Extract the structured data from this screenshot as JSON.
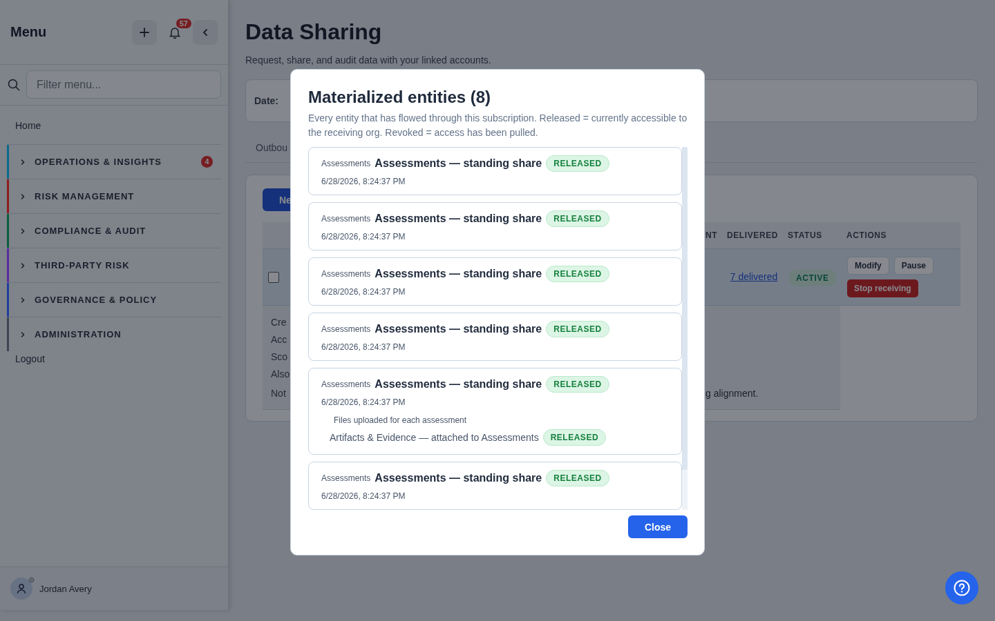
{
  "sidebar": {
    "title": "Menu",
    "notification_count": "57",
    "filter": {
      "placeholder": "Filter menu..."
    },
    "items": [
      {
        "kind": "link",
        "label": "Home"
      },
      {
        "kind": "group",
        "label": "OPERATIONS & INSIGHTS",
        "color": "#0b6a8c",
        "badge": "4",
        "expanded": false
      },
      {
        "kind": "group",
        "label": "RISK MANAGEMENT",
        "color": "#8f1d1d",
        "expanded": false
      },
      {
        "kind": "group",
        "label": "COMPLIANCE & AUDIT",
        "color": "#0b5e40",
        "expanded": false
      },
      {
        "kind": "group",
        "label": "THIRD-PARTY RISK",
        "color": "#5b2a9e",
        "expanded": false
      },
      {
        "kind": "group",
        "label": "GOVERNANCE & POLICY",
        "color": "#1f3d9e",
        "expanded": false
      },
      {
        "kind": "group",
        "label": "ADMINISTRATION",
        "color": "#3d4452",
        "expanded": false
      },
      {
        "kind": "link",
        "label": "Logout"
      }
    ],
    "user": {
      "name": "Jordan Avery"
    }
  },
  "page": {
    "title": "Data Sharing",
    "subtitle": "Request, share, and audit data with your linked accounts.",
    "filter_label": "Date:",
    "tabs": [
      {
        "label": "Outbou",
        "selected": false
      }
    ],
    "new_button": "Ne",
    "table": {
      "columns": [
        "NT",
        "DELIVERED",
        "STATUS",
        "ACTIONS"
      ],
      "rows": [
        {
          "checked": false,
          "delivered": "7 delivered",
          "status": "ACTIVE",
          "actions": [
            "Modify",
            "Pause"
          ],
          "danger_action": "Stop receiving"
        }
      ]
    },
    "details": {
      "lines": [
        "Cre",
        "Acc",
        "Sco",
        "Also",
        "Not"
      ],
      "tail": "g alignment."
    }
  },
  "modal": {
    "title": "Materialized entities (8)",
    "description": "Every entity that has flowed through this subscription. Released = currently accessible to the receiving org. Revoked = access has been pulled.",
    "entities": [
      {
        "category": "Assessments",
        "name": "Assessments — standing share",
        "status": "RELEASED",
        "timestamp": "6/28/2026, 8:24:37 PM"
      },
      {
        "category": "Assessments",
        "name": "Assessments — standing share",
        "status": "RELEASED",
        "timestamp": "6/28/2026, 8:24:37 PM"
      },
      {
        "category": "Assessments",
        "name": "Assessments — standing share",
        "status": "RELEASED",
        "timestamp": "6/28/2026, 8:24:37 PM"
      },
      {
        "category": "Assessments",
        "name": "Assessments — standing share",
        "status": "RELEASED",
        "timestamp": "6/28/2026, 8:24:37 PM"
      },
      {
        "category": "Assessments",
        "name": "Assessments — standing share",
        "status": "RELEASED",
        "timestamp": "6/28/2026, 8:24:37 PM",
        "children": [
          {
            "description": "Files uploaded for each assessment",
            "name": "Artifacts & Evidence — attached to Assessments",
            "status": "RELEASED"
          }
        ]
      },
      {
        "category": "Assessments",
        "name": "Assessments — standing share",
        "status": "RELEASED",
        "timestamp": "6/28/2026, 8:24:37 PM"
      }
    ],
    "close_button": "Close"
  }
}
